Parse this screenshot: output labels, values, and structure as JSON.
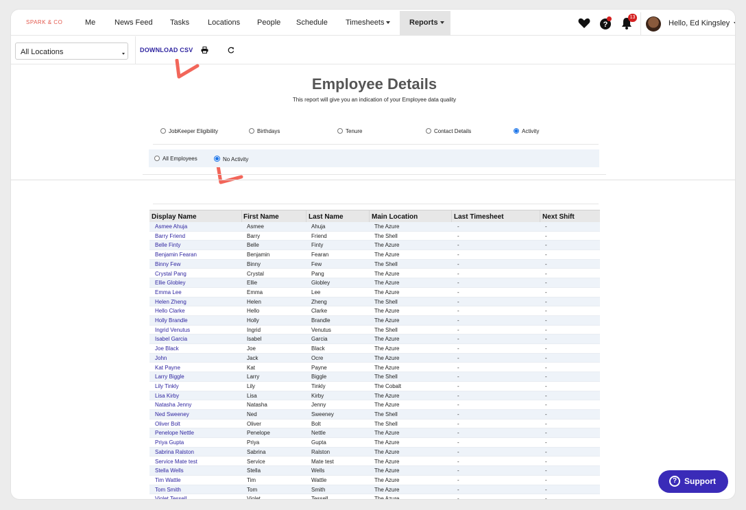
{
  "nav": {
    "brand": "SPARK & CO",
    "items": [
      "Me",
      "News Feed",
      "Tasks",
      "Locations",
      "People",
      "Schedule",
      "Timesheets"
    ],
    "reports_label": "Reports",
    "notifications_count": "13",
    "user_greeting": "Hello, Ed Kingsley"
  },
  "toolbar": {
    "location_value": "All Locations",
    "download_label": "DOWNLOAD CSV"
  },
  "page": {
    "title": "Employee Details",
    "subtitle": "This report will give you an indication of your Employee data quality"
  },
  "report_types": [
    {
      "label": "JobKeeper Eligibility",
      "selected": false
    },
    {
      "label": "Birthdays",
      "selected": false
    },
    {
      "label": "Tenure",
      "selected": false
    },
    {
      "label": "Contact Details",
      "selected": false
    },
    {
      "label": "Activity",
      "selected": true
    }
  ],
  "activity_filter": [
    {
      "label": "All Employees",
      "selected": false
    },
    {
      "label": "No Activity",
      "selected": true
    }
  ],
  "table": {
    "headers": [
      "Display Name",
      "First Name",
      "Last Name",
      "Main Location",
      "Last Timesheet",
      "Next Shift"
    ],
    "rows": [
      [
        "Asmee Ahuja",
        "Asmee",
        "Ahuja",
        "The Azure",
        "-",
        "-"
      ],
      [
        "Barry Friend",
        "Barry",
        "Friend",
        "The Shell",
        "-",
        "-"
      ],
      [
        "Belle Finty",
        "Belle",
        "Finty",
        "The Azure",
        "-",
        "-"
      ],
      [
        "Benjamin Fearan",
        "Benjamin",
        "Fearan",
        "The Azure",
        "-",
        "-"
      ],
      [
        "Binny Few",
        "Binny",
        "Few",
        "The Shell",
        "-",
        "-"
      ],
      [
        "Crystal Pang",
        "Crystal",
        "Pang",
        "The Azure",
        "-",
        "-"
      ],
      [
        "Ellie Globley",
        "Ellie",
        "Globley",
        "The Azure",
        "-",
        "-"
      ],
      [
        "Emma Lee",
        "Emma",
        "Lee",
        "The Azure",
        "-",
        "-"
      ],
      [
        "Helen Zheng",
        "Helen",
        "Zheng",
        "The Shell",
        "-",
        "-"
      ],
      [
        "Hello Clarke",
        "Hello",
        "Clarke",
        "The Azure",
        "-",
        "-"
      ],
      [
        "Holly Brandle",
        "Holly",
        "Brandle",
        "The Azure",
        "-",
        "-"
      ],
      [
        "Ingrid Venutus",
        "Ingrid",
        "Venutus",
        "The Shell",
        "-",
        "-"
      ],
      [
        "Isabel Garcia",
        "Isabel",
        "Garcia",
        "The Azure",
        "-",
        "-"
      ],
      [
        "Joe Black",
        "Joe",
        "Black",
        "The Azure",
        "-",
        "-"
      ],
      [
        "John",
        "Jack",
        "Ocre",
        "The Azure",
        "-",
        "-"
      ],
      [
        "Kat Payne",
        "Kat",
        "Payne",
        "The Azure",
        "-",
        "-"
      ],
      [
        "Larry Biggle",
        "Larry",
        "Biggle",
        "The Shell",
        "-",
        "-"
      ],
      [
        "Lily Tinkly",
        "Lily",
        "Tinkly",
        "The Cobalt",
        "-",
        "-"
      ],
      [
        "Lisa Kirby",
        "Lisa",
        "Kirby",
        "The Azure",
        "-",
        "-"
      ],
      [
        "Natasha Jenny",
        "Natasha",
        "Jenny",
        "The Azure",
        "-",
        "-"
      ],
      [
        "Ned Sweeney",
        "Ned",
        "Sweeney",
        "The Shell",
        "-",
        "-"
      ],
      [
        "Oliver Bolt",
        "Oliver",
        "Bolt",
        "The Shell",
        "-",
        "-"
      ],
      [
        "Penelope Nettle",
        "Penelope",
        "Nettle",
        "The Azure",
        "-",
        "-"
      ],
      [
        "Priya Gupta",
        "Priya",
        "Gupta",
        "The Azure",
        "-",
        "-"
      ],
      [
        "Sabrina Ralston",
        "Sabrina",
        "Ralston",
        "The Azure",
        "-",
        "-"
      ],
      [
        "Service Mate test",
        "Service",
        "Mate test",
        "The Azure",
        "-",
        "-"
      ],
      [
        "Stella Wells",
        "Stella",
        "Wells",
        "The Azure",
        "-",
        "-"
      ],
      [
        "Tim Wattle",
        "Tim",
        "Wattle",
        "The Azure",
        "-",
        "-"
      ],
      [
        "Tom Smith",
        "Tom",
        "Smith",
        "The Azure",
        "-",
        "-"
      ],
      [
        "Violet Tessell",
        "Violet",
        "Tessell",
        "The Azure",
        "-",
        "-"
      ]
    ]
  },
  "support": {
    "label": "Support"
  },
  "colors": {
    "accent": "#2f25a0",
    "support": "#3a2bb8",
    "annotation": "#f2665a",
    "badge": "#d42020"
  }
}
